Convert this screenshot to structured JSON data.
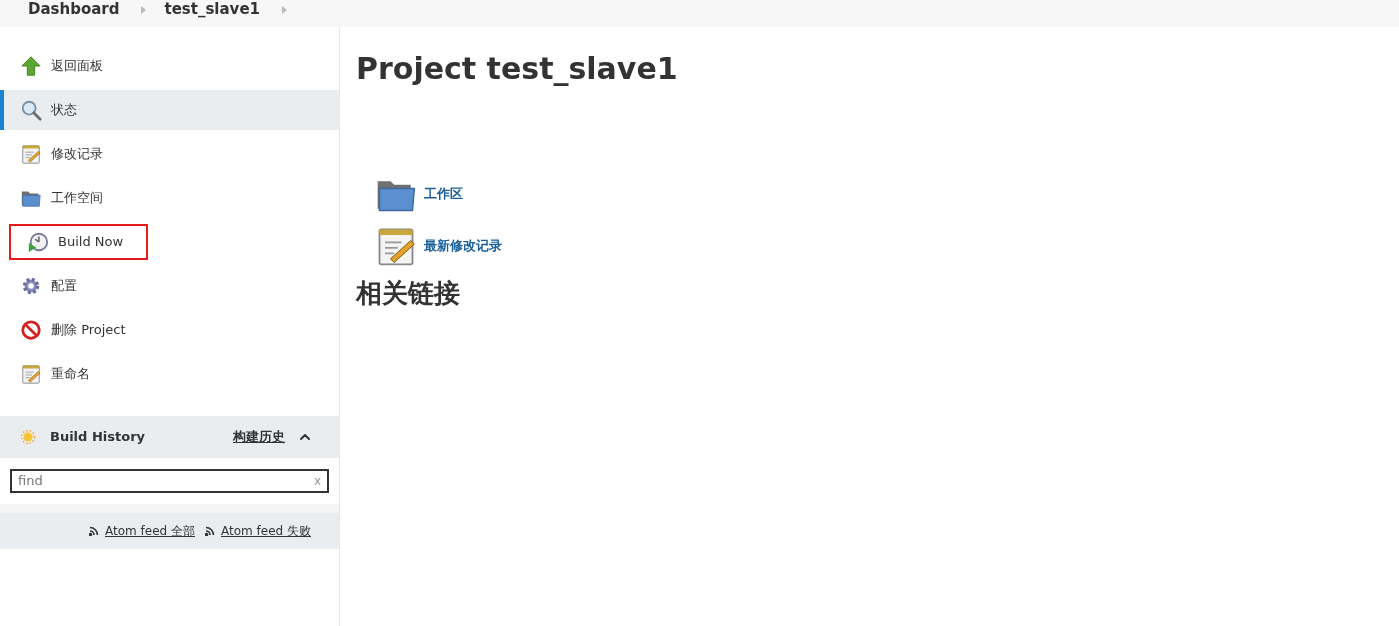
{
  "breadcrumbs": [
    "Dashboard",
    "test_slave1"
  ],
  "sidebar": {
    "items": [
      {
        "kind": "up",
        "label": "返回面板",
        "selected": false,
        "highlighted": false
      },
      {
        "kind": "search",
        "label": "状态",
        "selected": true,
        "highlighted": false
      },
      {
        "kind": "notepad",
        "label": "修改记录",
        "selected": false,
        "highlighted": false
      },
      {
        "kind": "folder",
        "label": "工作空间",
        "selected": false,
        "highlighted": false
      },
      {
        "kind": "clock",
        "label": "Build Now",
        "selected": false,
        "highlighted": true
      },
      {
        "kind": "gear",
        "label": "配置",
        "selected": false,
        "highlighted": false
      },
      {
        "kind": "forbidden",
        "label": "删除 Project",
        "selected": false,
        "highlighted": false
      },
      {
        "kind": "notepad",
        "label": "重命名",
        "selected": false,
        "highlighted": false
      }
    ]
  },
  "build_history": {
    "title": "Build History",
    "link": "构建历史",
    "search": {
      "placeholder": "find",
      "clear": "x"
    },
    "feeds": [
      "Atom feed 全部",
      "Atom feed 失败"
    ]
  },
  "main": {
    "title": "Project test_slave1",
    "links": [
      {
        "kind": "folder",
        "label": "工作区"
      },
      {
        "kind": "notepad",
        "label": "最新修改记录"
      }
    ],
    "related_heading": "相关链接"
  }
}
